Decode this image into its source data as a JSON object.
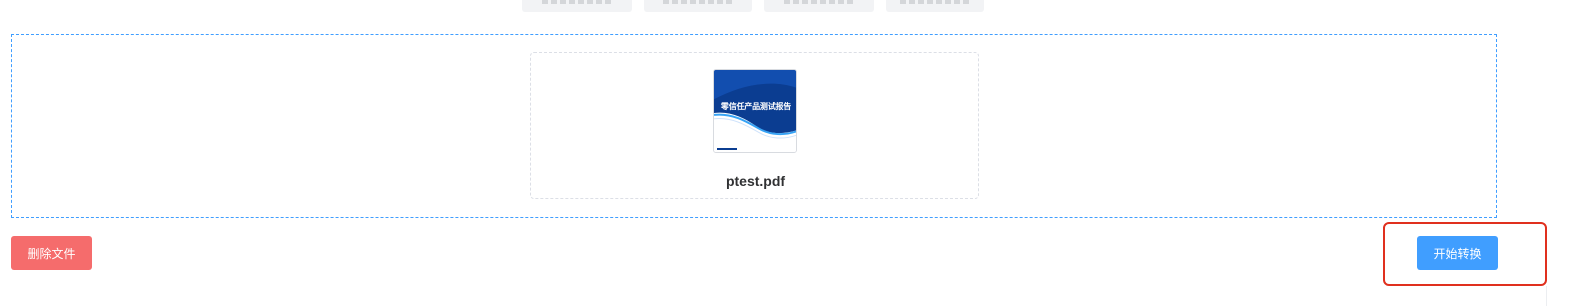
{
  "top_tabs": [
    {
      "label": ""
    },
    {
      "label": ""
    },
    {
      "label": ""
    },
    {
      "label": ""
    }
  ],
  "upload": {
    "file": {
      "name": "ptest.pdf",
      "thumbnail_title": "零信任产品测试报告"
    }
  },
  "actions": {
    "delete_label": "删除文件",
    "start_label": "开始转换"
  },
  "colors": {
    "accent": "#409eff",
    "danger": "#f56c6c",
    "highlight": "#e0301e",
    "thumbnail_blue": "#0b3d91"
  }
}
